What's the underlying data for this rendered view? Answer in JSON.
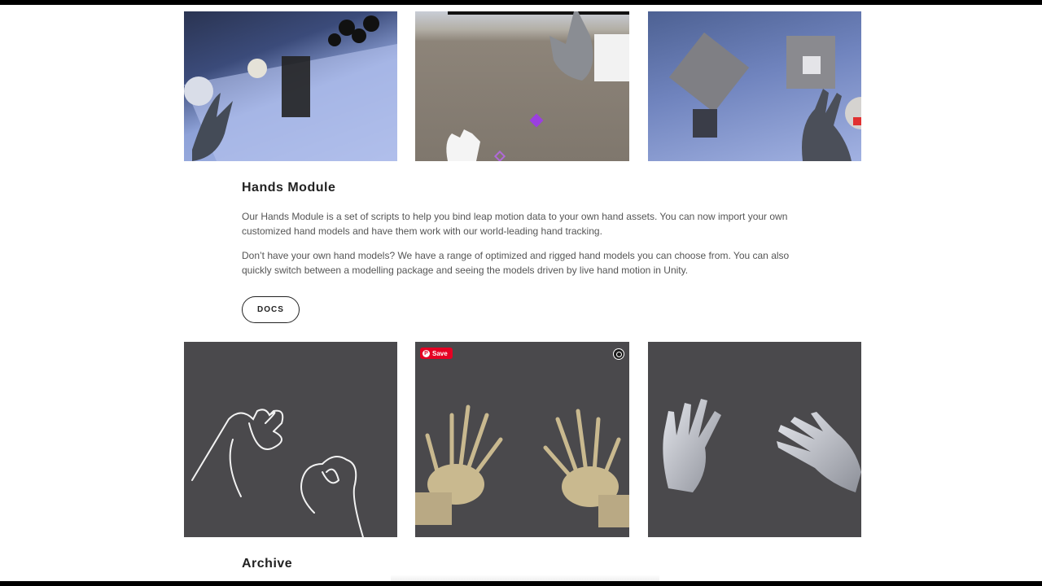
{
  "hands_module": {
    "title": "Hands Module",
    "paragraph1": "Our Hands Module is a set of scripts to help you bind leap motion data to your own hand assets.  You can now import your own customized hand models and have them work with our world-leading hand tracking.",
    "paragraph2": "Don’t have your own hand models? We have a range of optimized and rigged hand models you can choose from. You can also quickly switch between a modelling package and seeing the models driven by live hand motion in Unity.",
    "docs_label": "DOCS"
  },
  "gallery": {
    "save_label": "Save"
  },
  "archive": {
    "title": "Archive"
  }
}
